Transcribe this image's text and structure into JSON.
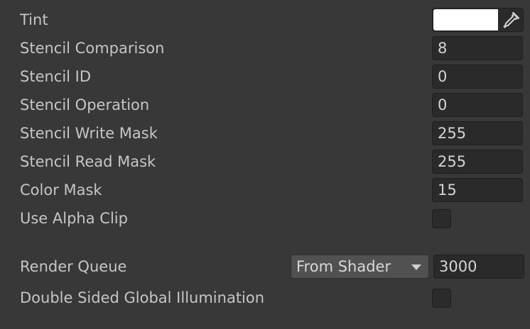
{
  "properties": [
    {
      "label": "Tint",
      "type": "color",
      "value_color": "#ffffff",
      "icon": "eyedropper-icon"
    },
    {
      "label": "Stencil Comparison",
      "type": "number",
      "value": "8"
    },
    {
      "label": "Stencil ID",
      "type": "number",
      "value": "0"
    },
    {
      "label": "Stencil Operation",
      "type": "number",
      "value": "0"
    },
    {
      "label": "Stencil Write Mask",
      "type": "number",
      "value": "255"
    },
    {
      "label": "Stencil Read Mask",
      "type": "number",
      "value": "255"
    },
    {
      "label": "Color Mask",
      "type": "number",
      "value": "15"
    },
    {
      "label": "Use Alpha Clip",
      "type": "checkbox",
      "checked": false
    }
  ],
  "render_queue": {
    "label": "Render Queue",
    "dropdown_value": "From Shader",
    "value": "3000"
  },
  "double_sided_gi": {
    "label": "Double Sided Global Illumination",
    "checked": false
  }
}
